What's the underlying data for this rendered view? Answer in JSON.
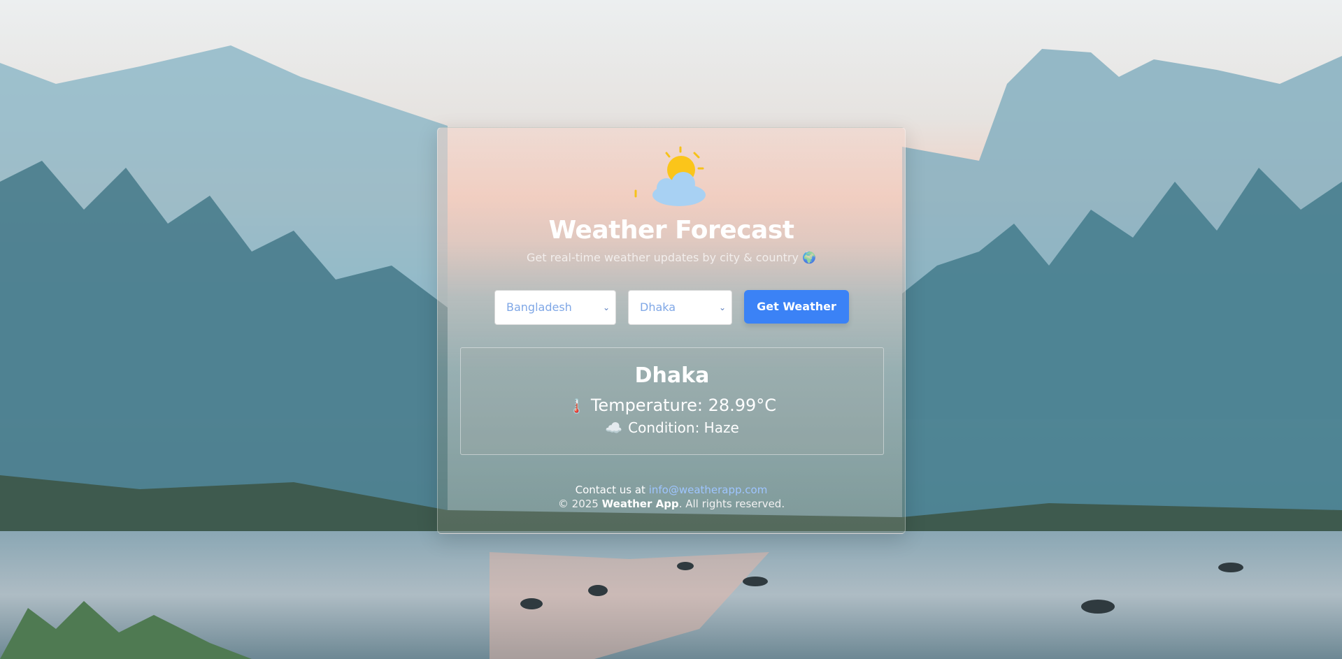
{
  "app": {
    "title": "Weather Forecast",
    "subtitle": "Get real-time weather updates by city & country 🌍"
  },
  "form": {
    "country_selected": "Bangladesh",
    "city_selected": "Dhaka",
    "submit_label": "Get Weather"
  },
  "result": {
    "city": "Dhaka",
    "temperature_icon": "🌡️",
    "temperature_text": "Temperature: 28.99°C",
    "condition_icon": "☁️",
    "condition_text": "Condition: Haze"
  },
  "footer": {
    "contact_prefix": "Contact us at",
    "contact_email": "info@weatherapp.com",
    "copyright_prefix": "© 2025",
    "copyright_brand": "Weather App",
    "copyright_suffix": ". All rights reserved."
  },
  "icons": {
    "logo": "sun-behind-cloud-icon",
    "select_chevron": "chevron-down-icon"
  },
  "colors": {
    "accent": "#3b82f6",
    "link": "#9ec5ff",
    "select_text": "#7fa7e6"
  }
}
